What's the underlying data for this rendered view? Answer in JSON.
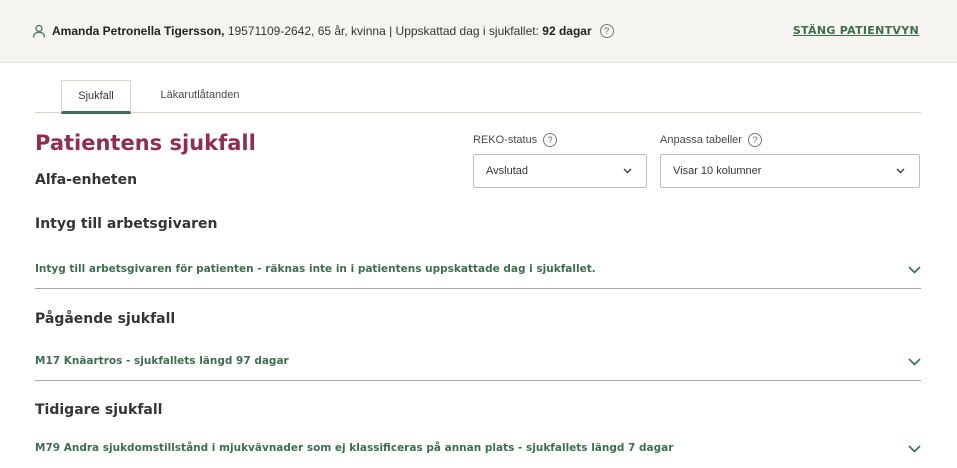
{
  "patient": {
    "name": "Amanda Petronella Tigersson,",
    "details": " 19571109-2642, 65 år, kvinna | Uppskattad dag i sjukfallet: ",
    "days": "92 dagar",
    "close_label": "STÄNG PATIENTVYN"
  },
  "tabs": [
    {
      "label": "Sjukfall",
      "active": true
    },
    {
      "label": "Läkarutlåtanden",
      "active": false
    }
  ],
  "main": {
    "title": "Patientens sjukfall",
    "unit": "Alfa-enheten"
  },
  "filters": {
    "reko": {
      "label": "REKO-status",
      "value": "Avslutad"
    },
    "tables": {
      "label": "Anpassa tabeller",
      "value": "Visar 10 kolumner"
    }
  },
  "sections": [
    {
      "title": "Intyg till arbetsgivaren",
      "row": "Intyg till arbetsgivaren för patienten - räknas inte in i patientens uppskattade dag i sjukfallet."
    },
    {
      "title": "Pågående sjukfall",
      "row": "M17 Knäartros - sjukfallets längd 97 dagar"
    },
    {
      "title": "Tidigare sjukfall",
      "row": "M79 Andra sjukdomstillstånd i mjukvävnader som ej klassificeras på annan plats - sjukfallets längd 7 dagar"
    }
  ],
  "help_glyph": "?",
  "colors": {
    "accent": "#3e6d4f",
    "title": "#8e2e52",
    "header_bg": "#f6f4ef"
  }
}
